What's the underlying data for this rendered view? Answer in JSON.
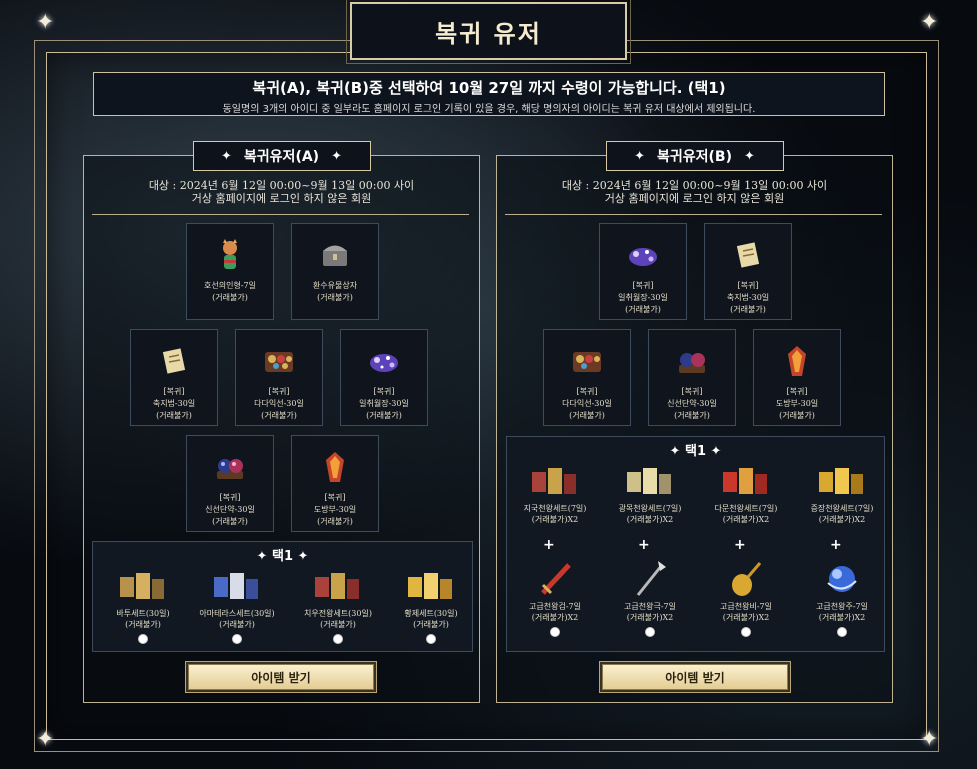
{
  "page_title": "복귀 유저",
  "notice": {
    "main": "복귀(A), 복귀(B)중 선택하여 10월 27일 까지 수령이 가능합니다. (택1)",
    "sub": "동일명의 3개의 아이디 중 일부라도 홈페이지 로그인 기록이 있을 경우, 해당 명의자의 아이디는 복귀 유저 대상에서 제외됩니다."
  },
  "panel_a": {
    "title": "복귀유저(A)",
    "target_line1": "대상 : 2024년 6월 12일 00:00~9월 13일 00:00 사이",
    "target_line2": "거상 홈페이지에 로그인 하지 않은 회원",
    "items": [
      {
        "line1": "",
        "line2": "호선의인형-7일",
        "line3": "(거래불가)",
        "icon": "doll-icon"
      },
      {
        "line1": "",
        "line2": "환수유물상자",
        "line3": "(거래불가)",
        "icon": "chest-icon"
      },
      {
        "line1": "[복귀]",
        "line2": "축지법-30일",
        "line3": "(거래불가)",
        "icon": "scroll-icon"
      },
      {
        "line1": "[복귀]",
        "line2": "다다익선-30일",
        "line3": "(거래불가)",
        "icon": "treasure-box-icon"
      },
      {
        "line1": "[복귀]",
        "line2": "일취월장-30일",
        "line3": "(거래불가)",
        "icon": "purple-orb-icon"
      },
      {
        "line1": "[복귀]",
        "line2": "신선단약-30일",
        "line3": "(거래불가)",
        "icon": "elixir-icon"
      },
      {
        "line1": "[복귀]",
        "line2": "도방부-30일",
        "line3": "(거래불가)",
        "icon": "talisman-icon"
      }
    ],
    "pick_title": "택1",
    "options": [
      {
        "line1": "바투세트(30일)",
        "line2": "(거래불가)",
        "icon": "armor-set-icon"
      },
      {
        "line1": "아마테라스세트(30일)",
        "line2": "(거래불가)",
        "icon": "armor-set-icon"
      },
      {
        "line1": "치우전왕세트(30일)",
        "line2": "(거래불가)",
        "icon": "armor-set-icon"
      },
      {
        "line1": "황제세트(30일)",
        "line2": "(거래불가)",
        "icon": "armor-set-icon"
      }
    ],
    "button": "아이템 받기"
  },
  "panel_b": {
    "title": "복귀유저(B)",
    "target_line1": "대상 : 2024년 6월 12일 00:00~9월 13일 00:00 사이",
    "target_line2": "거상 홈페이지에 로그인 하지 않은 회원",
    "items": [
      {
        "line1": "[복귀]",
        "line2": "일취월장-30일",
        "line3": "(거래불가)",
        "icon": "purple-orb-icon"
      },
      {
        "line1": "[복귀]",
        "line2": "축지법-30일",
        "line3": "(거래불가)",
        "icon": "scroll-icon"
      },
      {
        "line1": "[복귀]",
        "line2": "다다익선-30일",
        "line3": "(거래불가)",
        "icon": "treasure-box-icon"
      },
      {
        "line1": "[복귀]",
        "line2": "신선단약-30일",
        "line3": "(거래불가)",
        "icon": "elixir-icon"
      },
      {
        "line1": "[복귀]",
        "line2": "도방부-30일",
        "line3": "(거래불가)",
        "icon": "talisman-icon"
      }
    ],
    "pick_title": "택1",
    "sets": [
      {
        "line1": "지국천왕세트(7일)",
        "line2": "(거래불가)X2",
        "icon": "armor-set-icon"
      },
      {
        "line1": "광목천왕세트(7일)",
        "line2": "(거래불가)X2",
        "icon": "armor-set-icon"
      },
      {
        "line1": "다문천왕세트(7일)",
        "line2": "(거래불가)X2",
        "icon": "armor-set-icon"
      },
      {
        "line1": "증장천왕세트(7일)",
        "line2": "(거래불가)X2",
        "icon": "armor-set-icon"
      }
    ],
    "weapons": [
      {
        "line1": "고급천왕검-7일",
        "line2": "(거래불가)X2",
        "icon": "sword-icon"
      },
      {
        "line1": "고급천왕극-7일",
        "line2": "(거래불가)X2",
        "icon": "halberd-icon"
      },
      {
        "line1": "고급천왕비-7일",
        "line2": "(거래불가)X2",
        "icon": "lute-icon"
      },
      {
        "line1": "고급천왕주-7일",
        "line2": "(거래불가)X2",
        "icon": "blue-orb-icon"
      }
    ],
    "plus": "+",
    "button": "아이템 받기"
  }
}
